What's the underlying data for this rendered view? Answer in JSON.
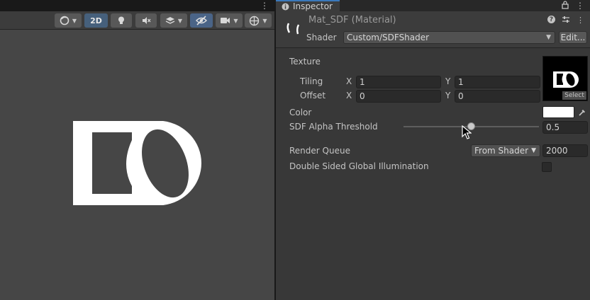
{
  "scene": {
    "toolbar": {
      "two_d_label": "2D"
    },
    "colors": {
      "background": "#464646",
      "shape": "#ffffff"
    }
  },
  "inspector": {
    "tab_label": "Inspector",
    "material_title": "Mat_SDF (Material)",
    "shader": {
      "label": "Shader",
      "value": "Custom/SDFShader",
      "edit_label": "Edit..."
    },
    "texture": {
      "label": "Texture",
      "tiling_label": "Tiling",
      "tiling_x": "1",
      "tiling_y": "1",
      "offset_label": "Offset",
      "offset_x": "0",
      "offset_y": "0",
      "x_label": "X",
      "y_label": "Y",
      "select_label": "Select"
    },
    "color": {
      "label": "Color",
      "value": "#ffffff"
    },
    "sdf_threshold": {
      "label": "SDF Alpha Threshold",
      "value": "0.5",
      "fraction": 0.5
    },
    "render_queue": {
      "label": "Render Queue",
      "mode": "From Shader",
      "value": "2000"
    },
    "double_sided_gi": {
      "label": "Double Sided Global Illumination",
      "checked": false
    },
    "accent_color": "#3a79bb"
  }
}
